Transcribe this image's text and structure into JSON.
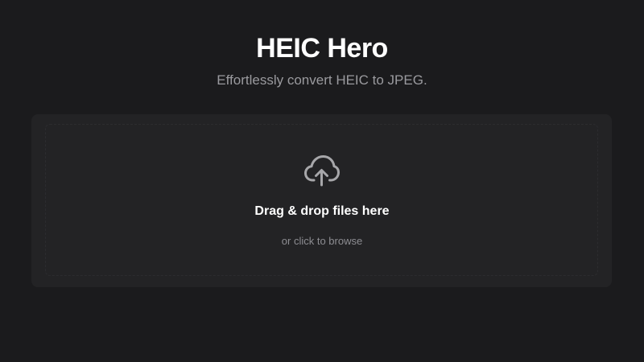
{
  "header": {
    "title": "HEIC Hero",
    "subtitle": "Effortlessly convert HEIC to JPEG."
  },
  "dropzone": {
    "icon": "cloud-upload-icon",
    "title": "Drag & drop files here",
    "hint": "or click to browse"
  },
  "colors": {
    "background": "#1b1b1d",
    "dropzone_background": "#232325",
    "dropzone_border": "#2c2c2f",
    "title_text": "#ffffff",
    "secondary_text": "#9a9a9e",
    "icon": "#a7a7aa"
  }
}
